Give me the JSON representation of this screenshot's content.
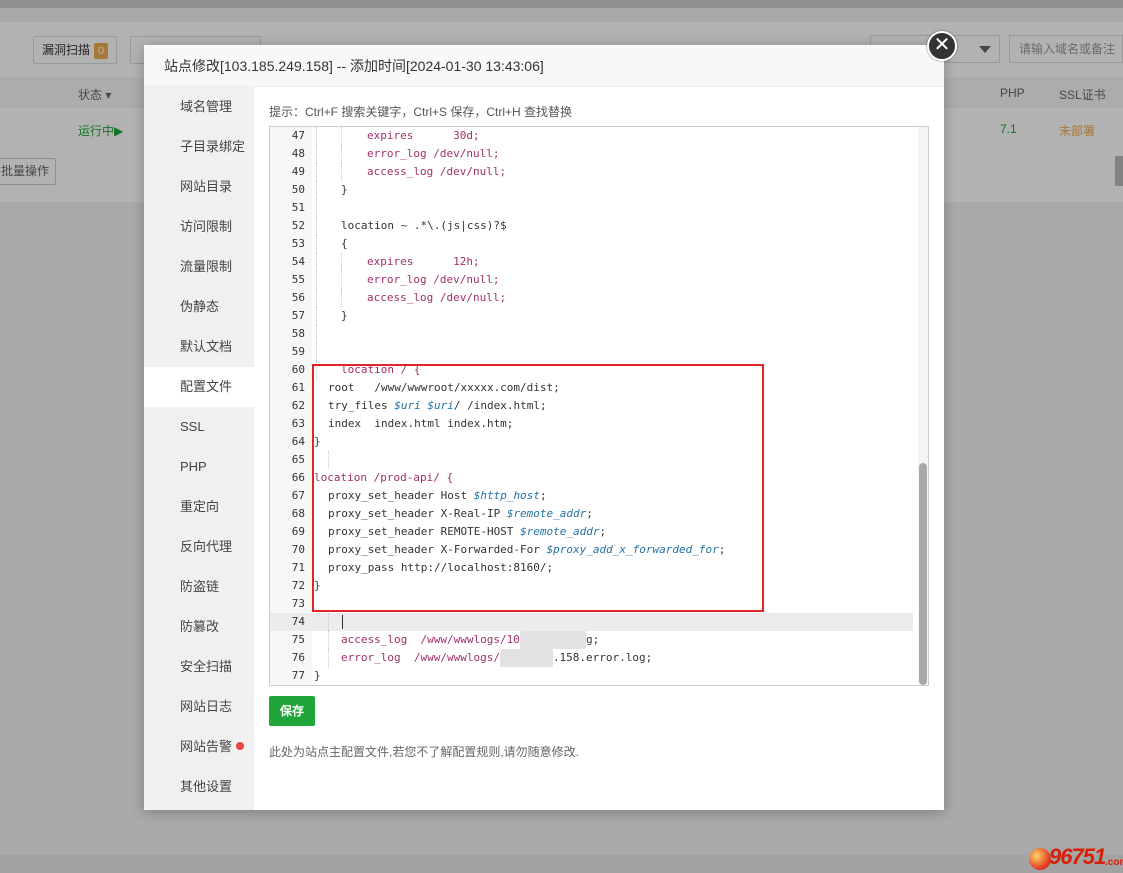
{
  "background": {
    "toolbar": {
      "scan_label": "漏洞扫描",
      "scan_count": "0",
      "search_placeholder": "请输入域名或备注"
    },
    "table": {
      "status_header": "状态",
      "php_header": "PHP",
      "ssl_header": "SSL证书",
      "row": {
        "status": "运行中▶",
        "php": "7.1",
        "ssl": "未部署"
      }
    },
    "batch_label": "批量操作"
  },
  "modal": {
    "title": "站点修改[103.185.249.158] -- 添加时间[2024-01-30 13:43:06]",
    "close_glyph": "✕",
    "sidebar": [
      {
        "label": "域名管理"
      },
      {
        "label": "子目录绑定"
      },
      {
        "label": "网站目录"
      },
      {
        "label": "访问限制"
      },
      {
        "label": "流量限制"
      },
      {
        "label": "伪静态"
      },
      {
        "label": "默认文档"
      },
      {
        "label": "配置文件",
        "active": true
      },
      {
        "label": "SSL"
      },
      {
        "label": "PHP"
      },
      {
        "label": "重定向"
      },
      {
        "label": "反向代理"
      },
      {
        "label": "防盗链"
      },
      {
        "label": "防篡改"
      },
      {
        "label": "安全扫描"
      },
      {
        "label": "网站日志"
      },
      {
        "label": "网站告警",
        "red_dot": true
      },
      {
        "label": "其他设置"
      }
    ],
    "hint": "提示：Ctrl+F 搜索关键字，Ctrl+S 保存，Ctrl+H 查找替换",
    "save_label": "保存",
    "note": "此处为站点主配置文件,若您不了解配置规则,请勿随意修改.",
    "current_line": "74",
    "code_lines": [
      {
        "n": "47",
        "text": "expires      30d;"
      },
      {
        "n": "48",
        "text": "error_log /dev/null;"
      },
      {
        "n": "49",
        "text": "access_log /dev/null;"
      },
      {
        "n": "50",
        "text": "}"
      },
      {
        "n": "51",
        "text": ""
      },
      {
        "n": "52",
        "text": "location ~ .*\\.(js|css)?$"
      },
      {
        "n": "53",
        "text": "{"
      },
      {
        "n": "54",
        "text": "expires      12h;"
      },
      {
        "n": "55",
        "text": "error_log /dev/null;"
      },
      {
        "n": "56",
        "text": "access_log /dev/null;"
      },
      {
        "n": "57",
        "text": "}"
      },
      {
        "n": "58",
        "text": ""
      },
      {
        "n": "59",
        "text": ""
      },
      {
        "n": "60",
        "text": "location / {"
      },
      {
        "n": "61",
        "text": "root   /www/wwwroot/xxxxx.com/dist;"
      },
      {
        "n": "62",
        "text": "try_files $uri $uri/ /index.html;"
      },
      {
        "n": "63",
        "text": "index  index.html index.htm;"
      },
      {
        "n": "64",
        "text": "}"
      },
      {
        "n": "65",
        "text": ""
      },
      {
        "n": "66",
        "text": "location /prod-api/ {"
      },
      {
        "n": "67",
        "text": "proxy_set_header Host $http_host;"
      },
      {
        "n": "68",
        "text": "proxy_set_header X-Real-IP $remote_addr;"
      },
      {
        "n": "69",
        "text": "proxy_set_header REMOTE-HOST $remote_addr;"
      },
      {
        "n": "70",
        "text": "proxy_set_header X-Forwarded-For $proxy_add_x_forwarded_for;"
      },
      {
        "n": "71",
        "text": "proxy_pass http://localhost:8160/;"
      },
      {
        "n": "72",
        "text": "}"
      },
      {
        "n": "73",
        "text": ""
      },
      {
        "n": "74",
        "text": ""
      },
      {
        "n": "75",
        "text": "access_log  /www/wwwlogs/10"
      },
      {
        "n": "75b",
        "text": "g;"
      },
      {
        "n": "76",
        "text": "error_log  /www/wwwlogs/"
      },
      {
        "n": "76b",
        "text": ".158.error.log;"
      },
      {
        "n": "77",
        "text": "}"
      }
    ]
  },
  "watermark": {
    "text": "96751",
    "suffix": ".com"
  }
}
